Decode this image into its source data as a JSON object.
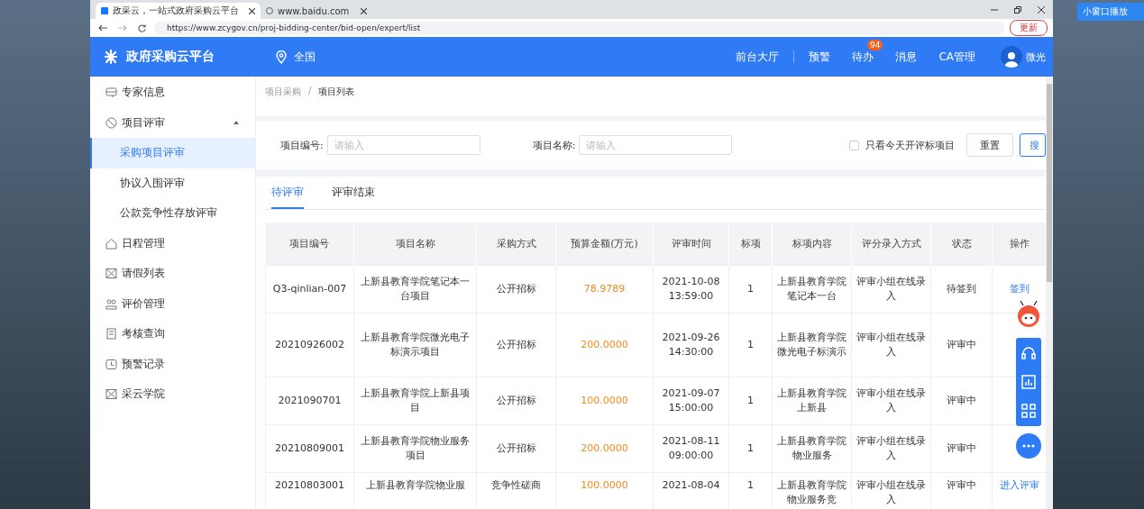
{
  "browser": {
    "tabs": [
      {
        "title": "政采云，一站式政府采购云平台",
        "selected": true
      },
      {
        "title": "www.baidu.com",
        "selected": false
      }
    ],
    "url": "https://www.zcygov.cn/proj-bidding-center/bid-open/expert/list",
    "update_button": "更新"
  },
  "player": {
    "mini_window": "小窗口播放"
  },
  "header": {
    "logo": "政府采购云平台",
    "region": "全国",
    "nav": [
      {
        "label": "前台大厅"
      },
      {
        "label": "预警"
      },
      {
        "label": "待办",
        "badge": "94"
      },
      {
        "label": "消息"
      },
      {
        "label": "CA管理"
      }
    ],
    "user": "微光"
  },
  "sidebar": {
    "items": [
      {
        "label": "专家信息",
        "selected": false
      },
      {
        "label": "项目评审",
        "selected": false,
        "expanded": true,
        "children": [
          {
            "label": "采购项目评审",
            "selected": true
          },
          {
            "label": "协议入围评审",
            "selected": false
          },
          {
            "label": "公款竞争性存放评审",
            "selected": false
          }
        ]
      },
      {
        "label": "日程管理",
        "selected": false
      },
      {
        "label": "请假列表",
        "selected": false
      },
      {
        "label": "评价管理",
        "selected": false
      },
      {
        "label": "考核查询",
        "selected": false
      },
      {
        "label": "预警记录",
        "selected": false
      },
      {
        "label": "采云学院",
        "selected": false
      }
    ]
  },
  "breadcrumb": {
    "items": [
      "项目采购",
      "项目列表"
    ],
    "separator": "/"
  },
  "filters": {
    "fields": [
      {
        "label": "项目编号:",
        "placeholder": "请输入"
      },
      {
        "label": "项目名称:",
        "placeholder": "请输入"
      }
    ],
    "today_only": {
      "label": "只看今天开评标项目",
      "checked": false
    },
    "reset": "重置",
    "search": "搜"
  },
  "tabs": [
    {
      "label": "待评审",
      "selected": true
    },
    {
      "label": "评审结束",
      "selected": false
    }
  ],
  "table": {
    "columns": [
      "项目编号",
      "项目名称",
      "采购方式",
      "预算金额(万元)",
      "评审时间",
      "标项",
      "标项内容",
      "评分录入方式",
      "状态",
      "操作"
    ],
    "rows": [
      {
        "cells": [
          "Q3-qinlian-007",
          "上新县教育学院笔记本一台项目",
          "公开招标",
          "78.9789",
          "2021-10-08 13:59:00",
          "1",
          "上新县教育学院笔记本一台",
          "评审小组在线录入",
          "待签到",
          "签到"
        ]
      },
      {
        "cells": [
          "20210926002",
          "上新县教育学院微光电子标演示项目",
          "公开招标",
          "200.0000",
          "2021-09-26 14:30:00",
          "1",
          "上新县教育学院微光电子标演示",
          "评审小组在线录入",
          "评审中",
          ""
        ]
      },
      {
        "cells": [
          "2021090701",
          "上新县教育学院上新县项目",
          "公开招标",
          "100.0000",
          "2021-09-07 15:00:00",
          "1",
          "上新县教育学院上新县",
          "评审小组在线录入",
          "评审中",
          ""
        ]
      },
      {
        "cells": [
          "20210809001",
          "上新县教育学院物业服务项目",
          "公开招标",
          "200.0000",
          "2021-08-11 09:00:00",
          "1",
          "上新县教育学院物业服务",
          "评审小组在线录入",
          "评审中",
          ""
        ]
      },
      {
        "cells": [
          "20210803001",
          "上新县教育学院物业服",
          "竞争性磋商",
          "100.0000",
          "2021-08-04",
          "1",
          "上新县教育学院物业服务竞",
          "评审小组在线录入",
          "评审中",
          "进入评审"
        ]
      }
    ]
  }
}
